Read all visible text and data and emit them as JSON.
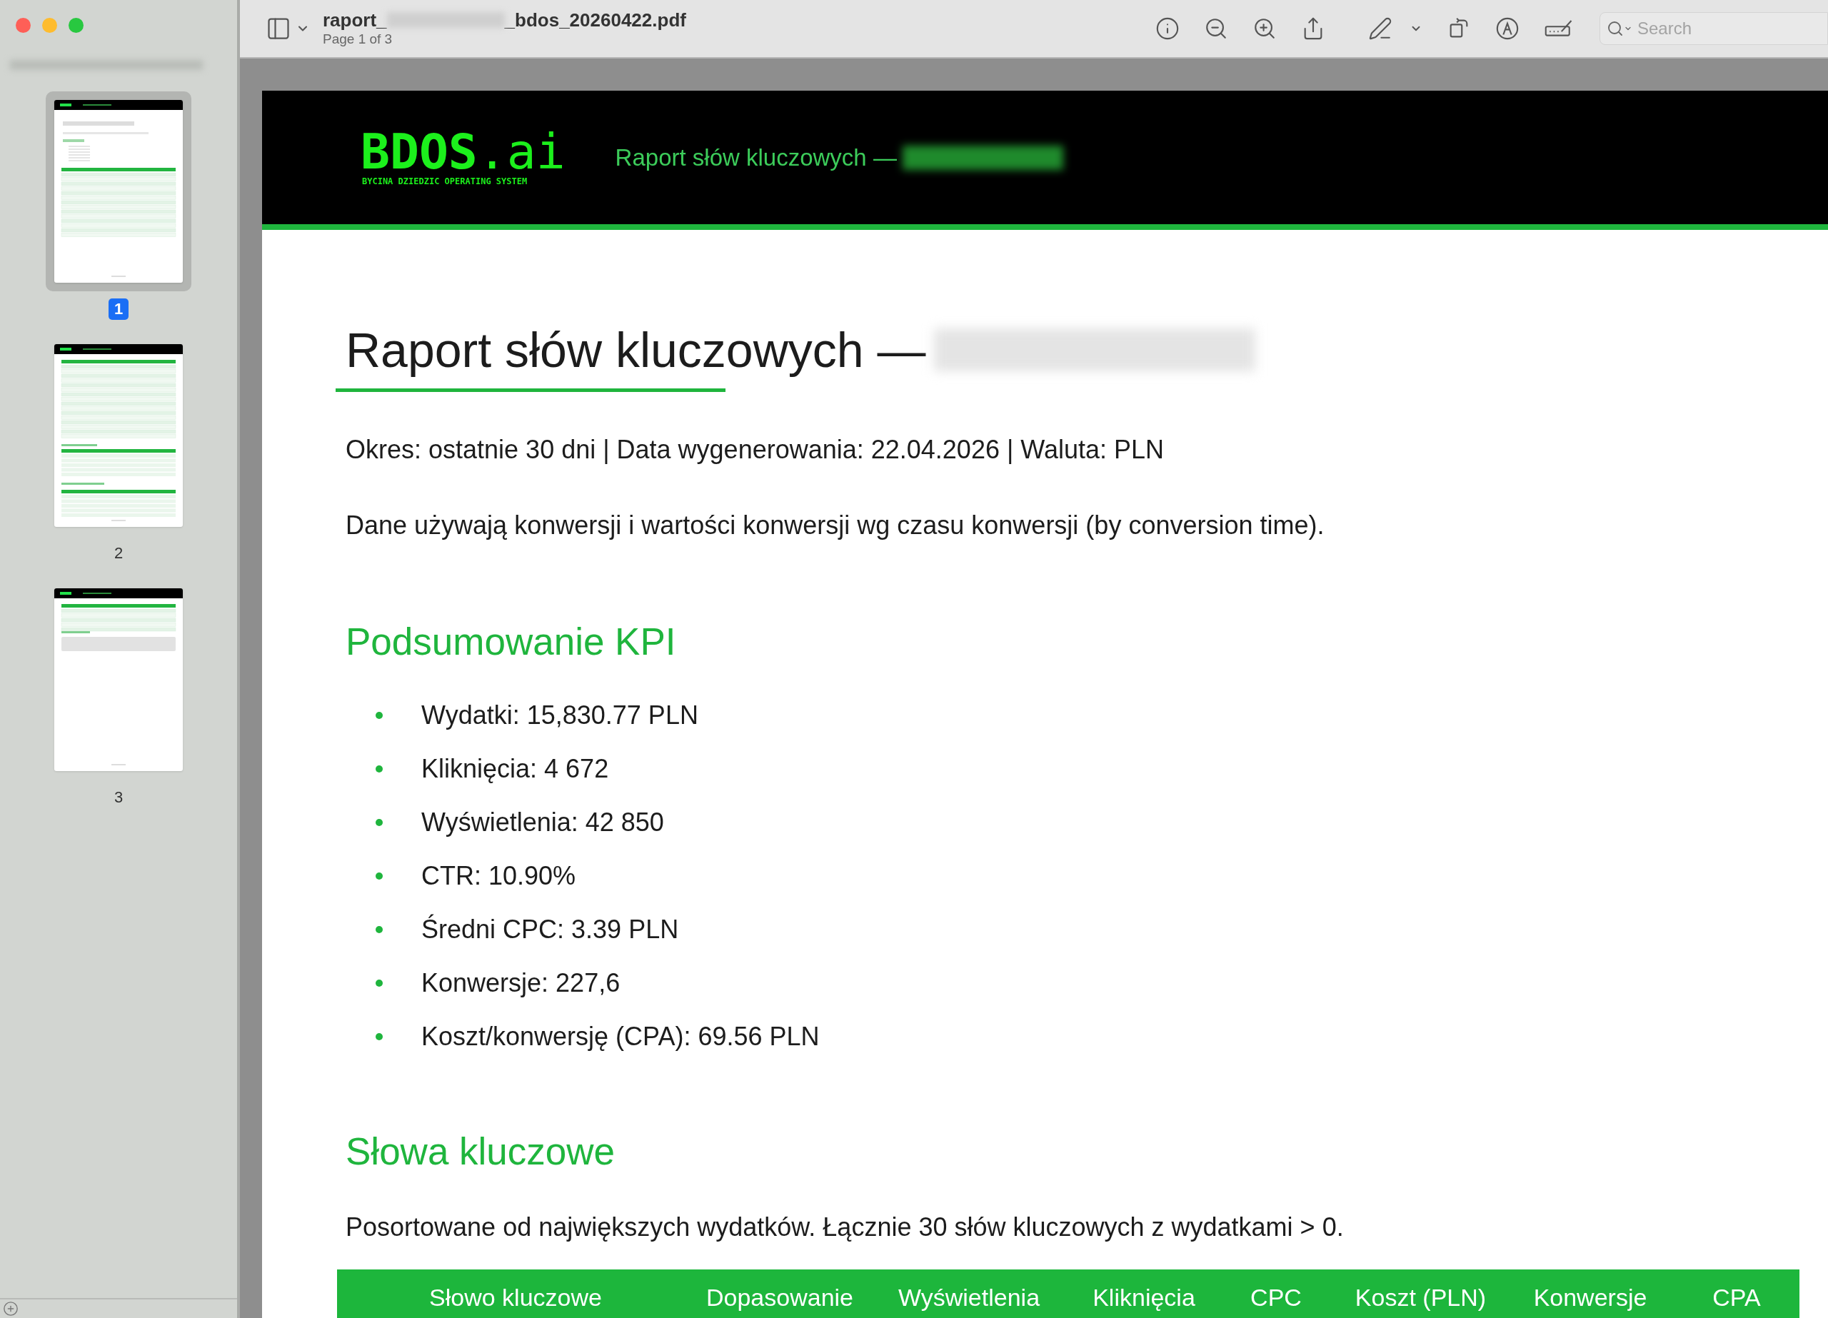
{
  "window": {
    "filename_start": "raport_",
    "filename_end": "_bdos_20260422.pdf",
    "page_indicator": "Page 1 of 3"
  },
  "toolbar": {
    "search": {
      "placeholder": "Search"
    }
  },
  "sidebar": {
    "pages": [
      {
        "label": "1",
        "selected": true
      },
      {
        "label": "2",
        "selected": false
      },
      {
        "label": "3",
        "selected": false
      }
    ]
  },
  "document": {
    "header": {
      "logo": "**BDOS**.ai",
      "tagline": "BYCINA DZIEDZIC OPERATING SYSTEM",
      "subtitle": "Raport słów kluczowych —"
    },
    "title": "Raport słów kluczowych —",
    "meta": "Okres: ostatnie 30 dni | Data wygenerowania: 22.04.2026 | Waluta: PLN",
    "note": "Dane używają konwersji i wartości konwersji wg czasu konwersji (by conversion time).",
    "kpi": {
      "heading": "Podsumowanie KPI",
      "items": [
        "Wydatki: 15,830.77 PLN",
        "Kliknięcia: 4 672",
        "Wyświetlenia: 42 850",
        "CTR: 10.90%",
        "Średni CPC: 3.39 PLN",
        "Konwersje: 227,6",
        "Koszt/konwersję (CPA): 69.56 PLN"
      ]
    },
    "keywords": {
      "heading": "Słowa kluczowe",
      "description": "Posortowane od największych wydatków. Łącznie 30 słów kluczowych z wydatkami > 0.",
      "table": {
        "columns": [
          "Słowo kluczowe",
          "Dopasowanie",
          "Wyświetlenia",
          "Kliknięcia",
          "CPC",
          "Koszt (PLN)",
          "Konwersje",
          "CPA"
        ]
      }
    }
  }
}
